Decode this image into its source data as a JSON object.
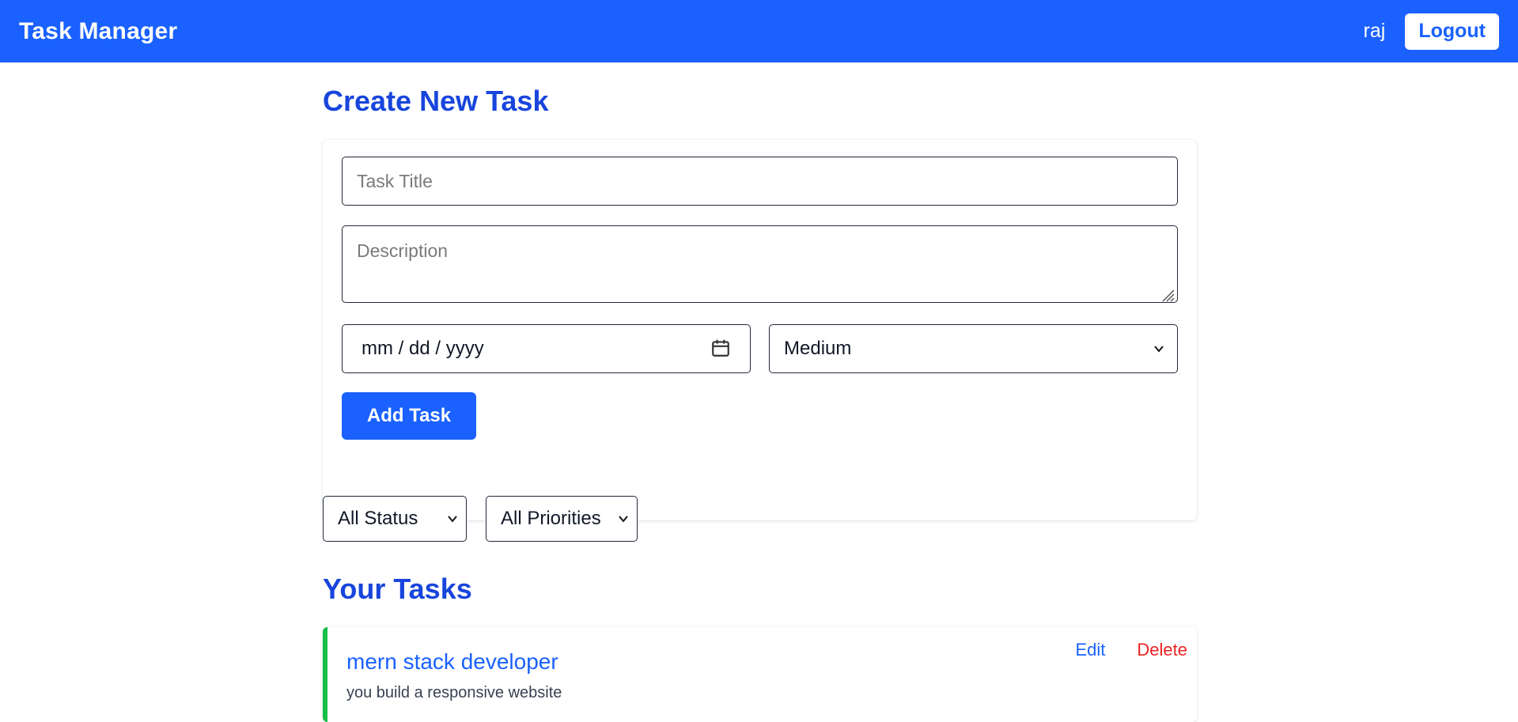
{
  "navbar": {
    "brand": "Task Manager",
    "username": "raj",
    "logout_label": "Logout"
  },
  "create": {
    "heading": "Create New Task",
    "title_placeholder": "Task Title",
    "description_placeholder": "Description",
    "date_placeholder": "mm / dd / yyyy",
    "priority_selected": "Medium",
    "add_label": "Add Task"
  },
  "filters": {
    "status_selected": "All Status",
    "priority_selected": "All Priorities"
  },
  "tasks": {
    "heading": "Your Tasks",
    "items": [
      {
        "title": "mern stack developer",
        "description": "you build a responsive website",
        "edit_label": "Edit",
        "delete_label": "Delete",
        "status_color": "#16c047"
      }
    ]
  },
  "colors": {
    "primary": "#1a61ff",
    "heading": "#1845dc",
    "danger": "#ef2222",
    "success": "#16c047"
  }
}
